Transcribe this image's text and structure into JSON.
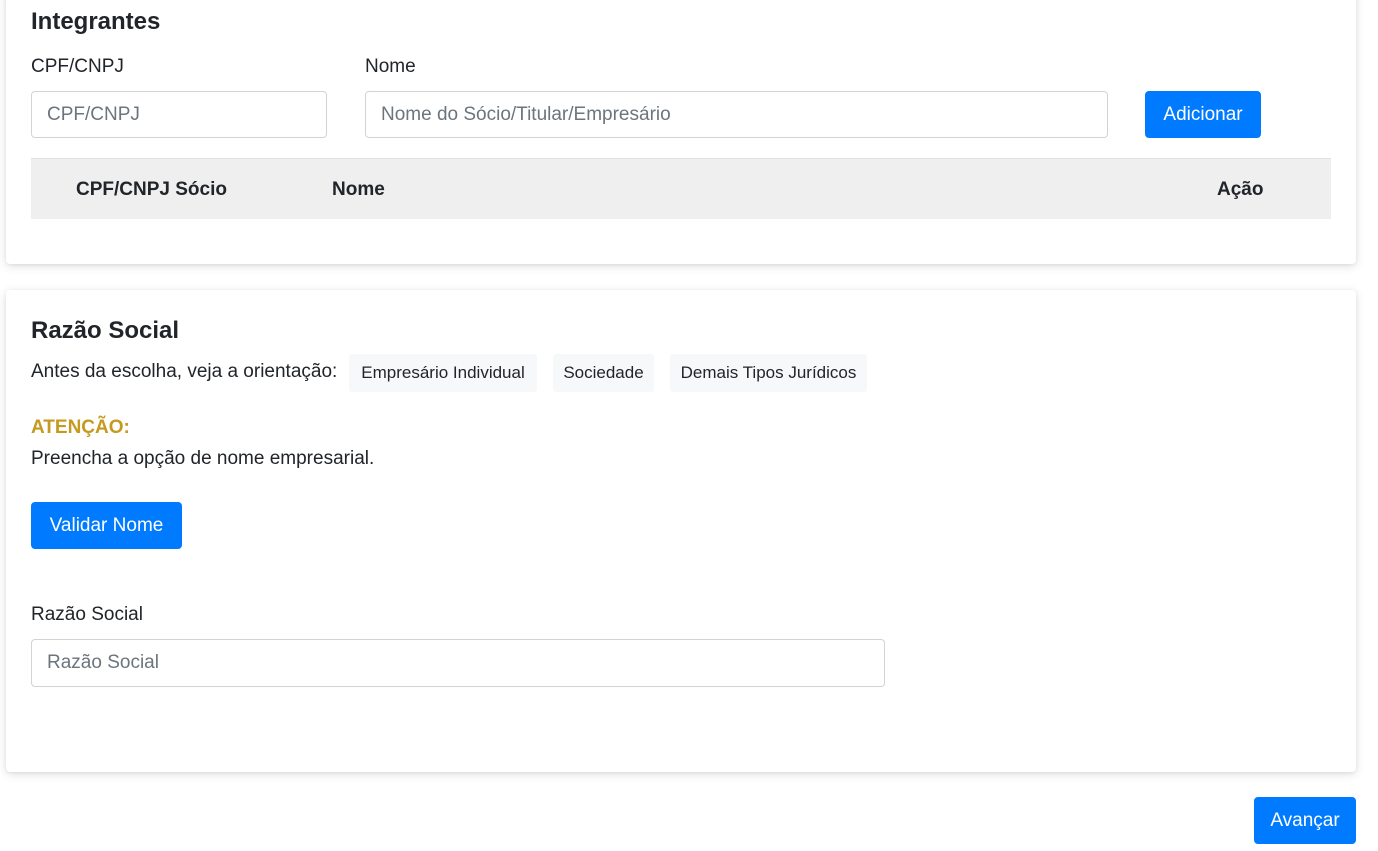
{
  "integrantes": {
    "title": "Integrantes",
    "cpf_label": "CPF/CNPJ",
    "cpf_placeholder": "CPF/CNPJ",
    "nome_label": "Nome",
    "nome_placeholder": "Nome do Sócio/Titular/Empresário",
    "add_button": "Adicionar",
    "table_headers": [
      "CPF/CNPJ Sócio",
      "Nome",
      "Ação"
    ]
  },
  "razao_social": {
    "title": "Razão Social",
    "orientation_text": "Antes da escolha, veja a orientação:",
    "orientation_links": [
      "Empresário Individual",
      "Sociedade",
      "Demais Tipos Jurídicos"
    ],
    "attention_label": "ATENÇÃO:",
    "attention_text": "Preencha a opção de nome empresarial.",
    "validate_button": "Validar Nome",
    "field_label": "Razão Social",
    "field_placeholder": "Razão Social"
  },
  "footer": {
    "next_button": "Avançar"
  },
  "colors": {
    "primary": "#007bff",
    "warning": "#c59a1e",
    "table_header_bg": "#efefef"
  }
}
